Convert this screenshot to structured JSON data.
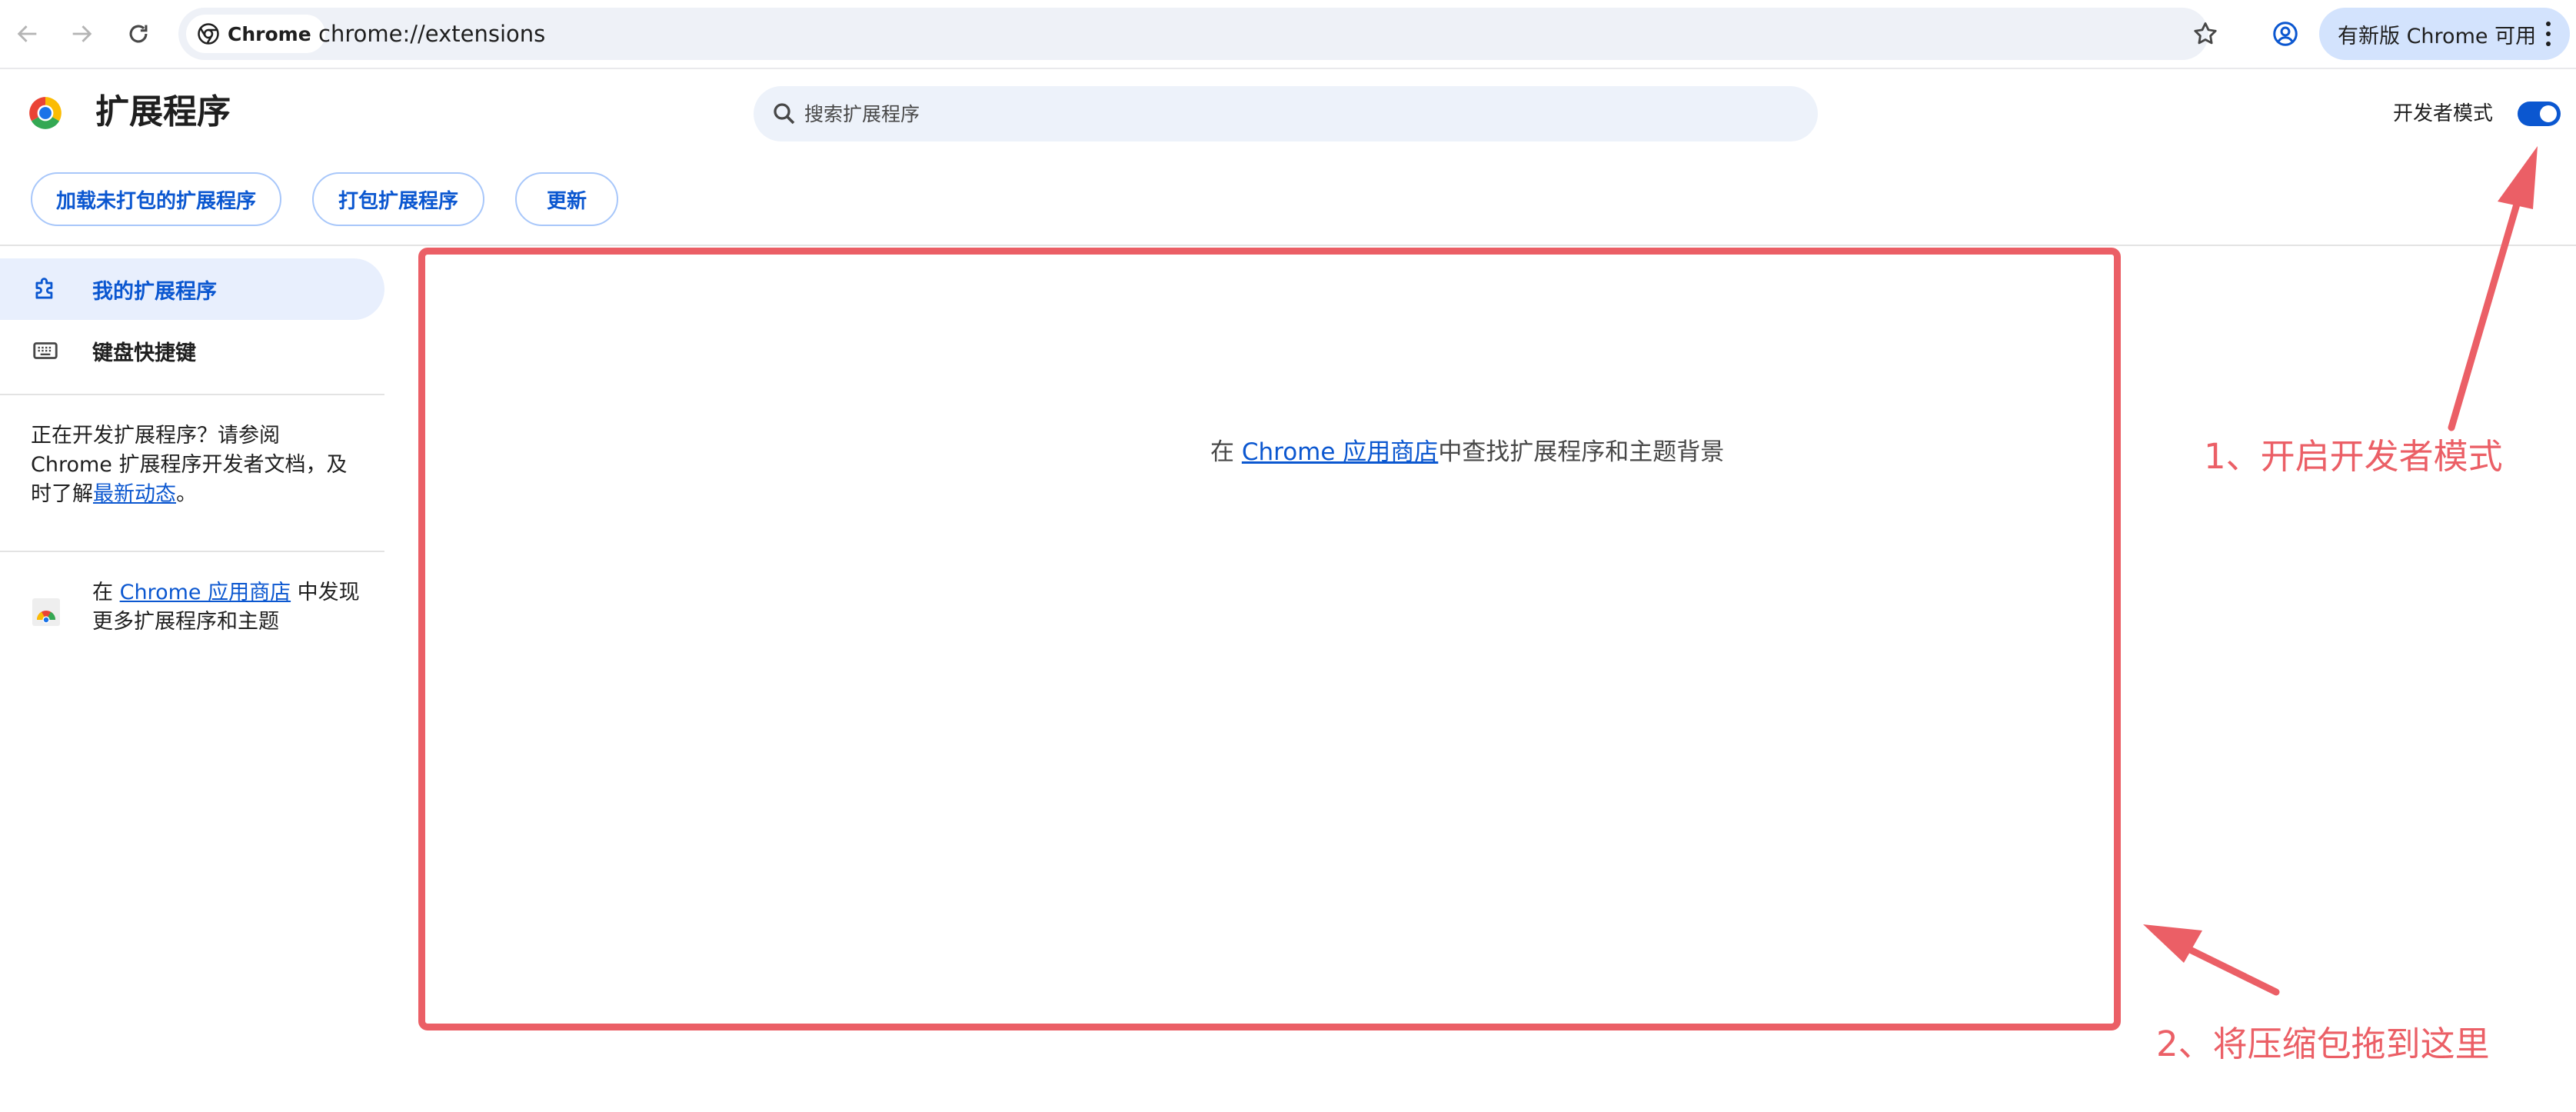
{
  "browser": {
    "omnibox": {
      "chip_label": "Chrome",
      "url": "chrome://extensions"
    },
    "update_label": "有新版 Chrome 可用"
  },
  "header": {
    "title": "扩展程序",
    "search_placeholder": "搜索扩展程序",
    "dev_mode_label": "开发者模式",
    "dev_mode_on": true
  },
  "actions": {
    "load_unpacked": "加载未打包的扩展程序",
    "pack": "打包扩展程序",
    "update": "更新"
  },
  "sidebar": {
    "items": [
      {
        "label": "我的扩展程序",
        "icon": "puzzle-icon",
        "active": true
      },
      {
        "label": "键盘快捷键",
        "icon": "keyboard-icon",
        "active": false
      }
    ],
    "dev_note": {
      "prefix": "正在开发扩展程序？请参阅 Chrome 扩展程序开发者文档，及时了解",
      "link": "最新动态",
      "suffix": "。"
    },
    "store_note": {
      "prefix": "在 ",
      "link": "Chrome 应用商店",
      "suffix": " 中发现更多扩展程序和主题"
    }
  },
  "main": {
    "message": {
      "prefix": "在 ",
      "link": "Chrome 应用商店",
      "suffix": "中查找扩展程序和主题背景"
    }
  },
  "annotations": {
    "step1": "1、开启开发者模式",
    "step2": "2、将压缩包拖到这里",
    "color": "#eb5f66"
  },
  "colors": {
    "accent": "#0b57d0",
    "update_button_bg": "#d3e3fd",
    "annotation_red": "#eb5f66"
  }
}
